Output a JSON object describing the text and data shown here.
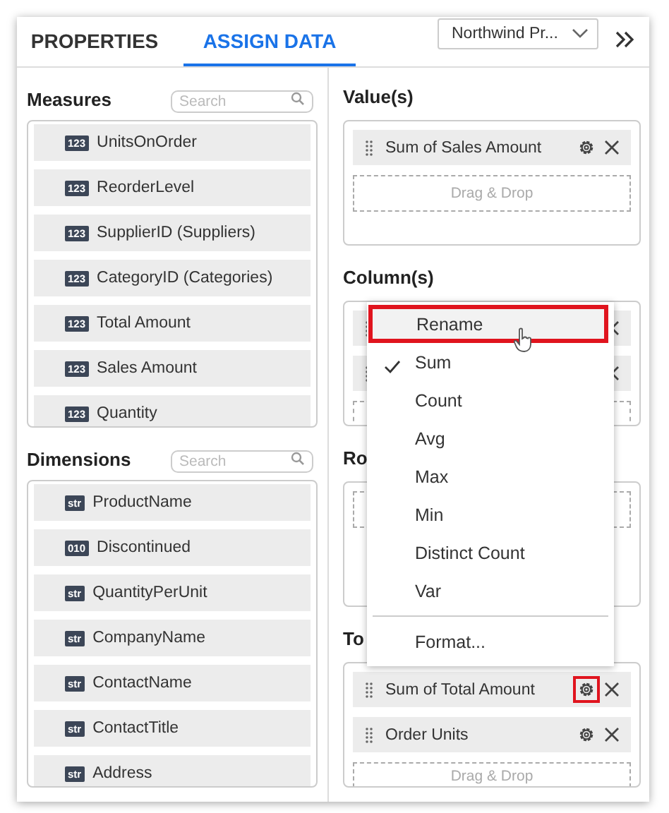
{
  "tabs": [
    {
      "label": "PROPERTIES",
      "selected": false
    },
    {
      "label": "ASSIGN DATA",
      "selected": true
    }
  ],
  "datasource": {
    "value": "Northwind Pr..."
  },
  "measures": {
    "title": "Measures",
    "search": {
      "placeholder": "Search"
    },
    "items": [
      {
        "type": "123",
        "name": "UnitsOnOrder"
      },
      {
        "type": "123",
        "name": "ReorderLevel"
      },
      {
        "type": "123",
        "name": "SupplierID (Suppliers)"
      },
      {
        "type": "123",
        "name": "CategoryID (Categories)"
      },
      {
        "type": "123",
        "name": "Total Amount"
      },
      {
        "type": "123",
        "name": "Sales Amount"
      },
      {
        "type": "123",
        "name": "Quantity"
      }
    ]
  },
  "dimensions": {
    "title": "Dimensions",
    "search": {
      "placeholder": "Search"
    },
    "items": [
      {
        "type": "str",
        "name": "ProductName"
      },
      {
        "type": "010",
        "name": "Discontinued"
      },
      {
        "type": "str",
        "name": "QuantityPerUnit"
      },
      {
        "type": "str",
        "name": "CompanyName"
      },
      {
        "type": "str",
        "name": "ContactName"
      },
      {
        "type": "str",
        "name": "ContactTitle"
      },
      {
        "type": "str",
        "name": "Address"
      }
    ]
  },
  "values": {
    "title": "Value(s)",
    "chips": [
      {
        "kind": "field",
        "label": "Sum of Sales Amount",
        "gear_highlighted": false
      }
    ],
    "drop_hint": "Drag & Drop"
  },
  "columns": {
    "title": "Column(s)",
    "chips": [
      {
        "kind": "covered"
      },
      {
        "kind": "covered"
      }
    ]
  },
  "rows": {
    "title": "Ro"
  },
  "totals": {
    "title": "To",
    "chips": [
      {
        "kind": "field",
        "label": "Sum of Total Amount",
        "gear_highlighted": true
      },
      {
        "kind": "field",
        "label": "Order Units",
        "gear_highlighted": false
      }
    ],
    "drop_hint": "Drag & Drop"
  },
  "menu": {
    "items": [
      {
        "kind": "option",
        "label": "Rename",
        "checked": false,
        "highlighted": true
      },
      {
        "kind": "option",
        "label": "Sum",
        "checked": true,
        "highlighted": false
      },
      {
        "kind": "option",
        "label": "Count",
        "checked": false,
        "highlighted": false
      },
      {
        "kind": "option",
        "label": "Avg",
        "checked": false,
        "highlighted": false
      },
      {
        "kind": "option",
        "label": "Max",
        "checked": false,
        "highlighted": false
      },
      {
        "kind": "option",
        "label": "Min",
        "checked": false,
        "highlighted": false
      },
      {
        "kind": "option",
        "label": "Distinct Count",
        "checked": false,
        "highlighted": false
      },
      {
        "kind": "option",
        "label": "Var",
        "checked": false,
        "highlighted": false
      },
      {
        "kind": "separator"
      },
      {
        "kind": "option",
        "label": "Format...",
        "checked": false,
        "highlighted": false
      }
    ]
  }
}
